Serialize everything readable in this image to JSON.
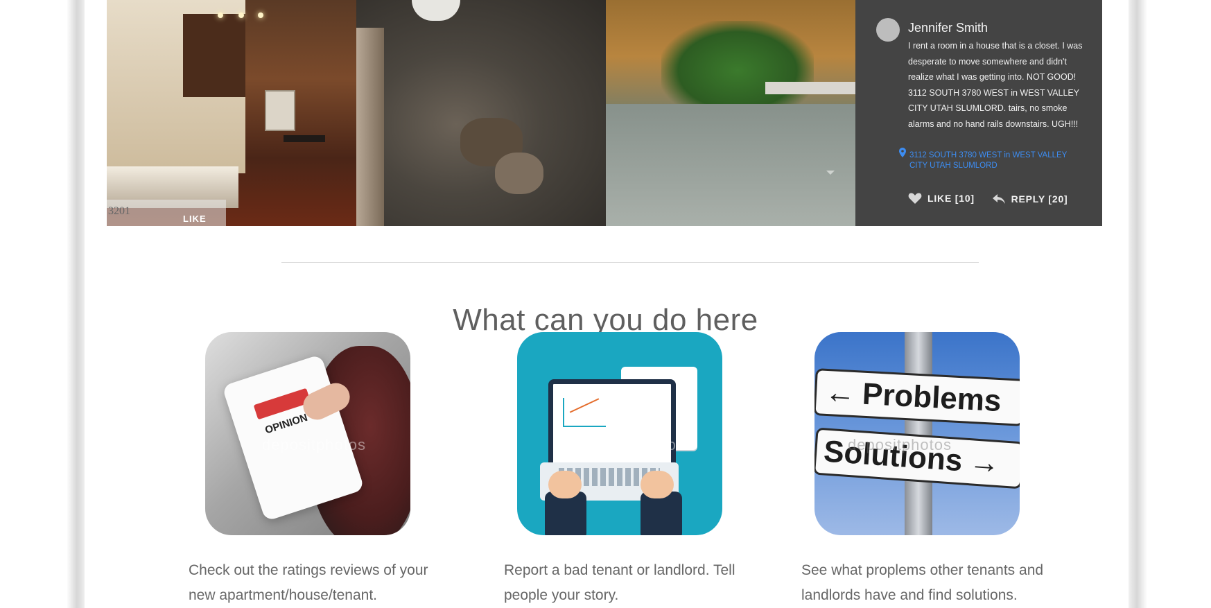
{
  "gallery": {
    "like_strip": {
      "number": "3201",
      "label": "LIKE"
    }
  },
  "review": {
    "name": "Jennifer Smith",
    "text": "I rent a room in a house that is a closet. I was desperate to move somewhere and didn't realize what I was getting into. NOT GOOD! 3112 SOUTH 3780 WEST in WEST VALLEY CITY UTAH SLUMLORD. tairs, no smoke alarms and no hand rails downstairs. UGH!!!",
    "address": "3112 SOUTH 3780 WEST in WEST VALLEY CITY UTAH SLUMLORD",
    "like_label": "LIKE [10]",
    "reply_label": "REPLY [20]",
    "icons": {
      "pin": "map-pin-icon",
      "like": "heart-icon",
      "reply": "reply-arrow-icon"
    },
    "colors": {
      "card_bg": "#444444",
      "link": "#3d8df2"
    }
  },
  "section": {
    "title": "What can you do here"
  },
  "features": [
    {
      "sign_text": "OPINION",
      "watermark": "depositphotos",
      "description": " Check out the ratings reviews of your new apartment/house/tenant."
    },
    {
      "watermark": "depositphotos",
      "description": "Report a bad tenant or landlord. Tell people your story."
    },
    {
      "sign_top": "Problems",
      "sign_bottom": "Solutions",
      "watermark": "depositphotos",
      "description": "See what proplems other tenants and landlords have and find solutions."
    }
  ]
}
